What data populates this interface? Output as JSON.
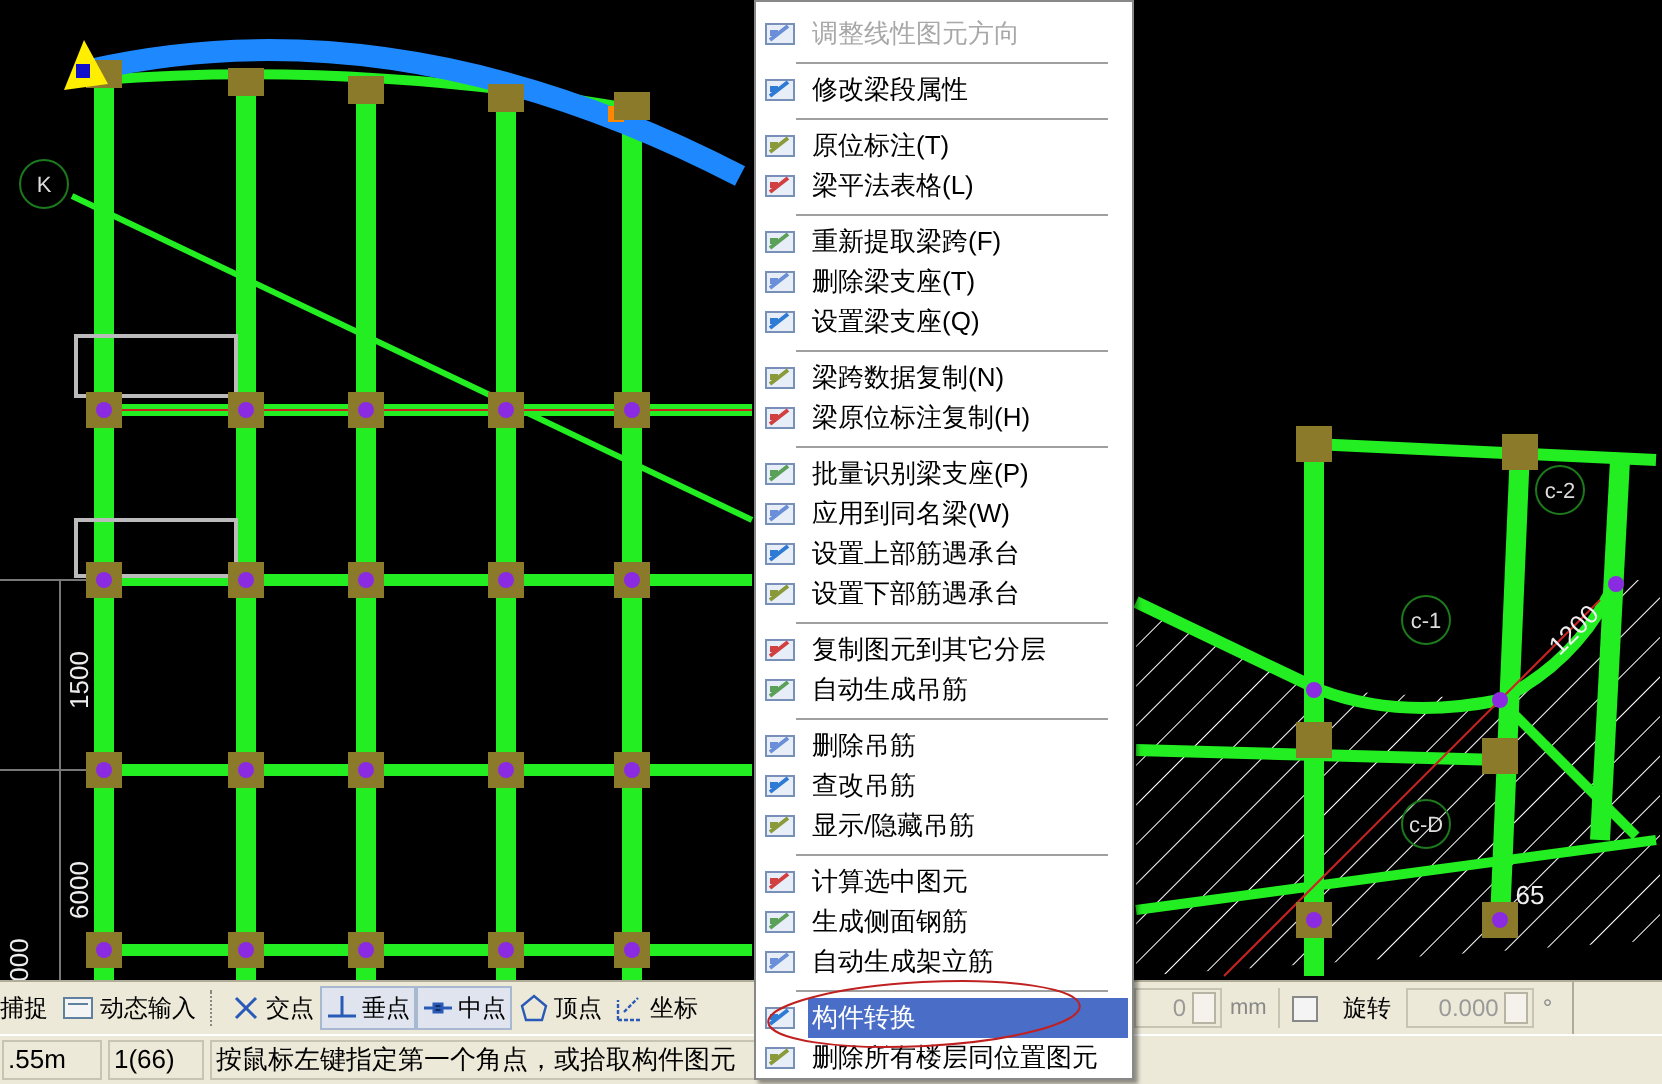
{
  "canvas": {
    "labels": [
      {
        "kind": "axis",
        "text": "K"
      },
      {
        "kind": "axis",
        "text": "c-2"
      },
      {
        "kind": "axis",
        "text": "c-1"
      },
      {
        "kind": "axis",
        "text": "c-D"
      },
      {
        "kind": "dimension",
        "text": "1200"
      },
      {
        "kind": "dimension",
        "text": "1500"
      },
      {
        "kind": "dimension",
        "text": "6000"
      },
      {
        "kind": "dimension",
        "text": "000"
      },
      {
        "kind": "dimension",
        "text": "65"
      }
    ]
  },
  "context_menu": {
    "items": [
      {
        "kind": "item",
        "label": "调整线性图元方向",
        "disabled": true,
        "selected": false
      },
      {
        "kind": "separator"
      },
      {
        "kind": "item",
        "label": "修改梁段属性",
        "disabled": false,
        "selected": false
      },
      {
        "kind": "separator"
      },
      {
        "kind": "item",
        "label": "原位标注(T)",
        "disabled": false,
        "selected": false
      },
      {
        "kind": "item",
        "label": "梁平法表格(L)",
        "disabled": false,
        "selected": false
      },
      {
        "kind": "separator"
      },
      {
        "kind": "item",
        "label": "重新提取梁跨(F)",
        "disabled": false,
        "selected": false
      },
      {
        "kind": "item",
        "label": "删除梁支座(T)",
        "disabled": false,
        "selected": false
      },
      {
        "kind": "item",
        "label": "设置梁支座(Q)",
        "disabled": false,
        "selected": false
      },
      {
        "kind": "separator"
      },
      {
        "kind": "item",
        "label": "梁跨数据复制(N)",
        "disabled": false,
        "selected": false
      },
      {
        "kind": "item",
        "label": "梁原位标注复制(H)",
        "disabled": false,
        "selected": false
      },
      {
        "kind": "separator"
      },
      {
        "kind": "item",
        "label": "批量识别梁支座(P)",
        "disabled": false,
        "selected": false
      },
      {
        "kind": "item",
        "label": "应用到同名梁(W)",
        "disabled": false,
        "selected": false
      },
      {
        "kind": "item",
        "label": "设置上部筋遇承台",
        "disabled": false,
        "selected": false
      },
      {
        "kind": "item",
        "label": "设置下部筋遇承台",
        "disabled": false,
        "selected": false
      },
      {
        "kind": "separator"
      },
      {
        "kind": "item",
        "label": "复制图元到其它分层",
        "disabled": false,
        "selected": false
      },
      {
        "kind": "item",
        "label": "自动生成吊筋",
        "disabled": false,
        "selected": false
      },
      {
        "kind": "separator"
      },
      {
        "kind": "item",
        "label": "删除吊筋",
        "disabled": false,
        "selected": false
      },
      {
        "kind": "item",
        "label": "查改吊筋",
        "disabled": false,
        "selected": false
      },
      {
        "kind": "item",
        "label": "显示/隐藏吊筋",
        "disabled": false,
        "selected": false
      },
      {
        "kind": "separator"
      },
      {
        "kind": "item",
        "label": "计算选中图元",
        "disabled": false,
        "selected": false
      },
      {
        "kind": "item",
        "label": "生成侧面钢筋",
        "disabled": false,
        "selected": false
      },
      {
        "kind": "item",
        "label": "自动生成架立筋",
        "disabled": false,
        "selected": false
      },
      {
        "kind": "separator"
      },
      {
        "kind": "item",
        "label": "构件转换",
        "disabled": false,
        "selected": true
      },
      {
        "kind": "item",
        "label": "删除所有楼层同位置图元",
        "disabled": false,
        "selected": false
      }
    ]
  },
  "toolbar": {
    "snap_label": "捕捉",
    "dynamic_input": {
      "label": "动态输入",
      "on": false
    },
    "snaps": [
      {
        "label": "交点",
        "on": false
      },
      {
        "label": "垂点",
        "on": true
      },
      {
        "label": "中点",
        "on": true
      },
      {
        "label": "顶点",
        "on": false
      },
      {
        "label": "坐标",
        "on": false
      }
    ],
    "offset": {
      "value": "0",
      "unit": "mm"
    },
    "rotate": {
      "checked": false,
      "label": "旋转",
      "value": "0.000",
      "disabled": true,
      "unit": "°"
    }
  },
  "status_bar": {
    "cells": [
      ".55m",
      "1(66)",
      "按鼠标左键指定第一个角点，或拾取构件图元"
    ]
  }
}
